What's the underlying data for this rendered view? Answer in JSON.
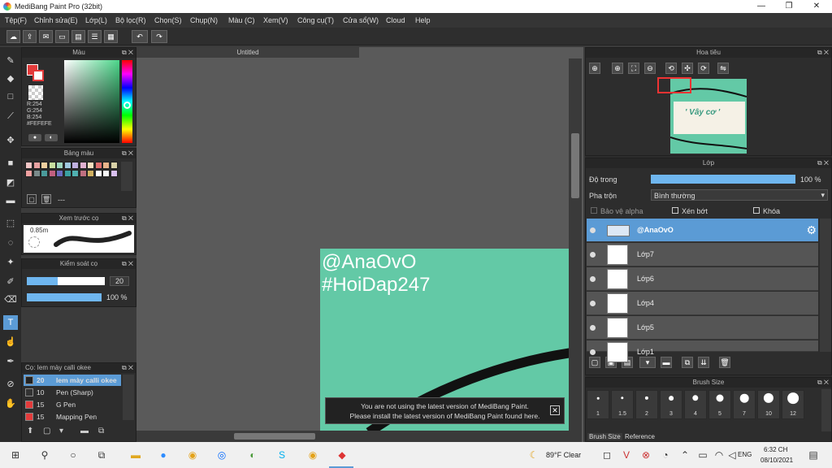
{
  "window": {
    "title": "MediBang Paint Pro (32bit)"
  },
  "menu": [
    "Tệp(F)",
    "Chỉnh sửa(E)",
    "Lớp(L)",
    "Bộ lọc(R)",
    "Chọn(S)",
    "Chụp(N)",
    "Màu (C)",
    "Xem(V)",
    "Công cụ(T)",
    "Cửa sổ(W)",
    "Cloud",
    "Help"
  ],
  "color_panel": {
    "title": "Màu",
    "r": "R:254",
    "g": "G:254",
    "b": "B:254",
    "hex": "#FEFEFE",
    "fg_color": "#fefefe",
    "accent": "#e33b3b"
  },
  "palette_panel": {
    "title": "Bảng màu",
    "label": "---",
    "swatches": [
      "#f2c6c6",
      "#e8a2a2",
      "#f0d0a0",
      "#c8e0a0",
      "#a0d8c0",
      "#a0c8e0",
      "#c0b0e0",
      "#e0b0d0",
      "#f8e0c0",
      "#e07070",
      "#e9b48a",
      "#d9d2a8",
      "#f0a0a0",
      "#7a8a8a",
      "#4a9a9a",
      "#c06080",
      "#6c6cc0",
      "#3aa0a0",
      "#50b0b0",
      "#c07080",
      "#d0b060",
      "#ffffff",
      "#f8f8f8",
      "#d9c0f0"
    ]
  },
  "preview_panel": {
    "title": "Xem trước cọ",
    "size": "0.85m"
  },
  "control_panel": {
    "title": "Kiểm soát cọ",
    "size_value": "20",
    "opacity_value": "100 %",
    "size_fraction": 0.4,
    "opacity_fraction": 1.0
  },
  "brush_panel": {
    "title": "Cọ: Iem mày calli okee",
    "items": [
      {
        "size": "20",
        "name": "Iem mày calli okee",
        "color": "#222222",
        "selected": true
      },
      {
        "size": "10",
        "name": "Pen (Sharp)",
        "color": "#333333",
        "selected": false
      },
      {
        "size": "15",
        "name": "G Pen",
        "color": "#e33b3b",
        "selected": false
      },
      {
        "size": "15",
        "name": "Mapping Pen",
        "color": "#e33b3b",
        "selected": false
      }
    ]
  },
  "document": {
    "tab": "Untitled",
    "text1": "@AnaOvO",
    "text2": "#HoiDap247"
  },
  "notice": {
    "line1": "You are not using the latest version of MediBang Paint.",
    "line2": "Please install the latest version of MediBang Paint found here."
  },
  "navigator": {
    "title": "Hoa tiêu",
    "preview_text": "' Vây cơ '"
  },
  "layer_panel": {
    "title": "Lớp",
    "opacity_label": "Độ trong",
    "opacity_value": "100 %",
    "opacity_fraction": 1.0,
    "blend_label": "Pha trộn",
    "blend_value": "Bình thường",
    "protect_alpha": "Bảo vệ alpha",
    "clipping": "Xén bớt",
    "lock": "Khóa",
    "layers": [
      "@AnaOvO",
      "Lớp7",
      "Lớp6",
      "Lớp4",
      "Lớp5",
      "Lớp1"
    ]
  },
  "brush_size_panel": {
    "title": "Brush Size",
    "sizes": [
      "1",
      "1.5",
      "2",
      "3",
      "4",
      "5",
      "7",
      "10",
      "12"
    ],
    "tabs": [
      "Brush Size",
      "Reference"
    ]
  },
  "taskbar": {
    "weather": "89°F  Clear",
    "lang": "ENG",
    "time": "6:32 CH",
    "date": "08/10/2021"
  }
}
